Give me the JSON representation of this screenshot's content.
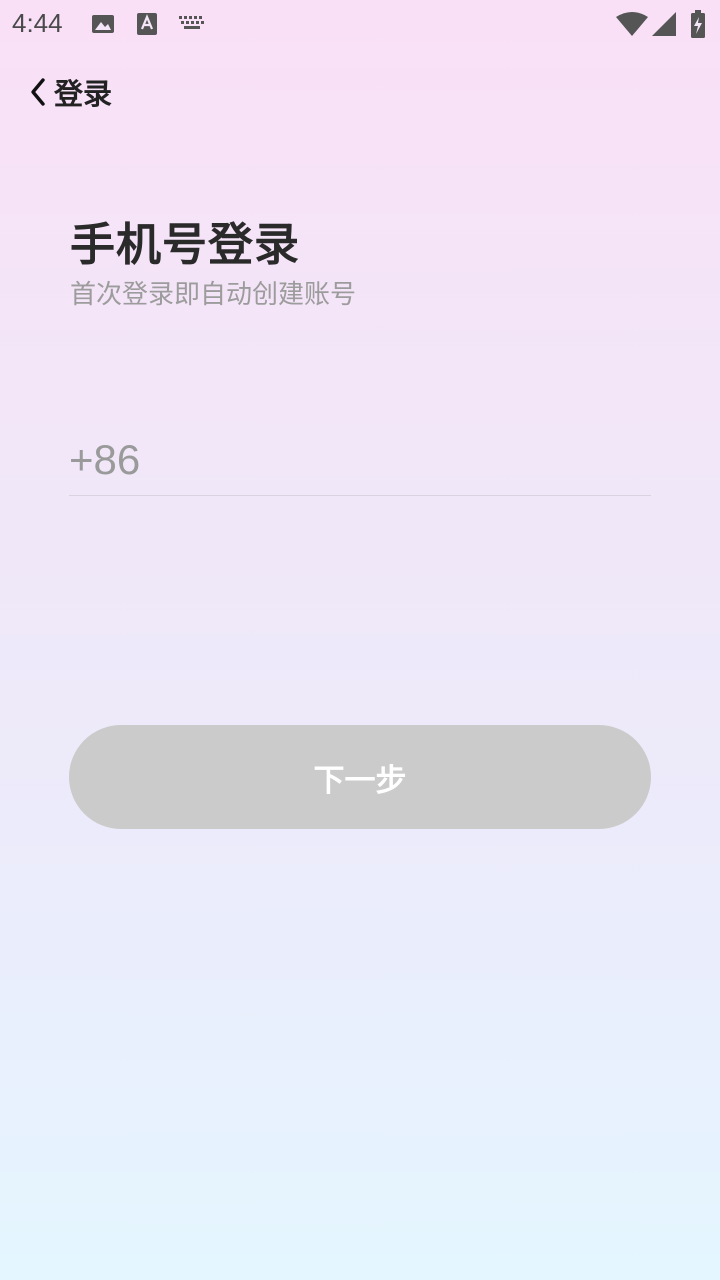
{
  "status_bar": {
    "time": "4:44",
    "icons": [
      "image-icon",
      "text-a-icon",
      "keyboard-icon",
      "wifi-icon",
      "cell-signal-icon",
      "battery-charging-icon"
    ]
  },
  "nav": {
    "back_icon": "chevron-left-icon",
    "title": "登录"
  },
  "header": {
    "title": "手机号登录",
    "subtitle": "首次登录即自动创建账号"
  },
  "phone_field": {
    "country_code": "+86",
    "value": "",
    "placeholder": ""
  },
  "next_button": {
    "label": "下一步"
  },
  "colors": {
    "button_disabled": "#cbcbcb",
    "title_text": "#2a2a2a",
    "subtitle_text": "#9c9c9c",
    "background_top": "#fae0f7",
    "background_bottom": "#e4f6ff"
  }
}
